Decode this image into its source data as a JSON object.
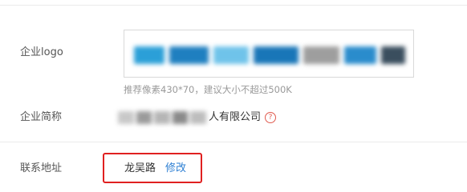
{
  "fields": {
    "logo": {
      "label": "企业logo",
      "hint": "推荐像素430*70，建议大小不超过500K"
    },
    "short_name": {
      "label": "企业简称",
      "value_visible_suffix": "人有限公司",
      "help_icon": "?"
    },
    "address": {
      "label": "联系地址",
      "value": "龙吴路",
      "edit_link": "修改"
    }
  },
  "colors": {
    "label_text": "#555555",
    "hint_text": "#999999",
    "link": "#2d7fd3",
    "highlight_border": "#e02020",
    "help_icon": "#e05a4e"
  }
}
